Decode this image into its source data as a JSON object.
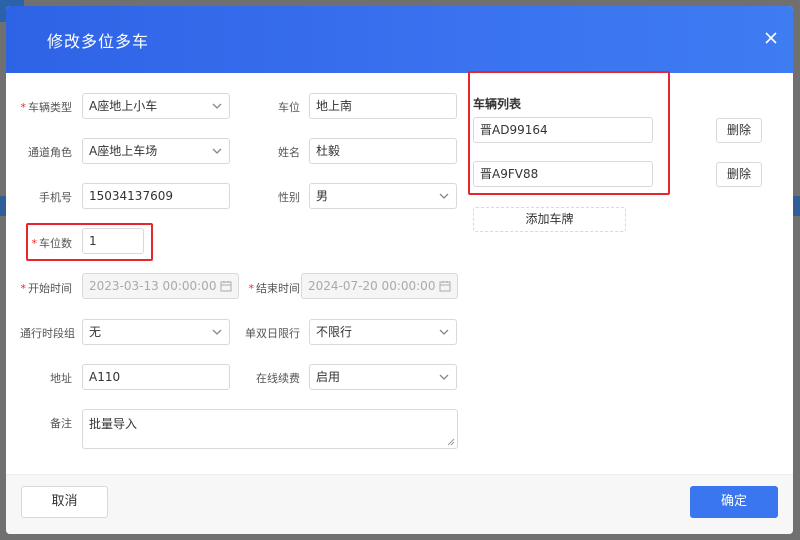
{
  "dialog": {
    "title": "修改多位多车",
    "close_icon": "close-icon"
  },
  "form": {
    "vehicle_type": {
      "label": "车辆类型",
      "required": true,
      "value": "A座地上小车"
    },
    "parking_space": {
      "label": "车位",
      "value": "地上南"
    },
    "channel_role": {
      "label": "通道角色",
      "value": "A座地上车场"
    },
    "name": {
      "label": "姓名",
      "value": "杜毅"
    },
    "phone": {
      "label": "手机号",
      "value": "15034137609"
    },
    "gender": {
      "label": "性别",
      "value": "男"
    },
    "space_count": {
      "label": "车位数",
      "required": true,
      "value": "1"
    },
    "start_time": {
      "label": "开始时间",
      "required": true,
      "value": "2023-03-13 00:00:00"
    },
    "end_time": {
      "label": "结束时间",
      "required": true,
      "value": "2024-07-20 00:00:00"
    },
    "pass_period_group": {
      "label": "通行时段组",
      "value": "无"
    },
    "odd_even_limit": {
      "label": "单双日限行",
      "value": "不限行"
    },
    "address": {
      "label": "地址",
      "value": "A110"
    },
    "online_renewal": {
      "label": "在线续费",
      "value": "启用"
    },
    "remark": {
      "label": "备注",
      "value": "批量导入"
    }
  },
  "vehicles": {
    "title": "车辆列表",
    "plates": [
      "晋AD99164",
      "晋A9FV88"
    ],
    "delete_label": "删除",
    "add_label": "添加车牌"
  },
  "footer": {
    "cancel_label": "取消",
    "confirm_label": "确定"
  },
  "colors": {
    "header": "#3a72f0",
    "primary": "#3a76f0",
    "highlight": "#e5262d",
    "required": "#f5222d"
  }
}
